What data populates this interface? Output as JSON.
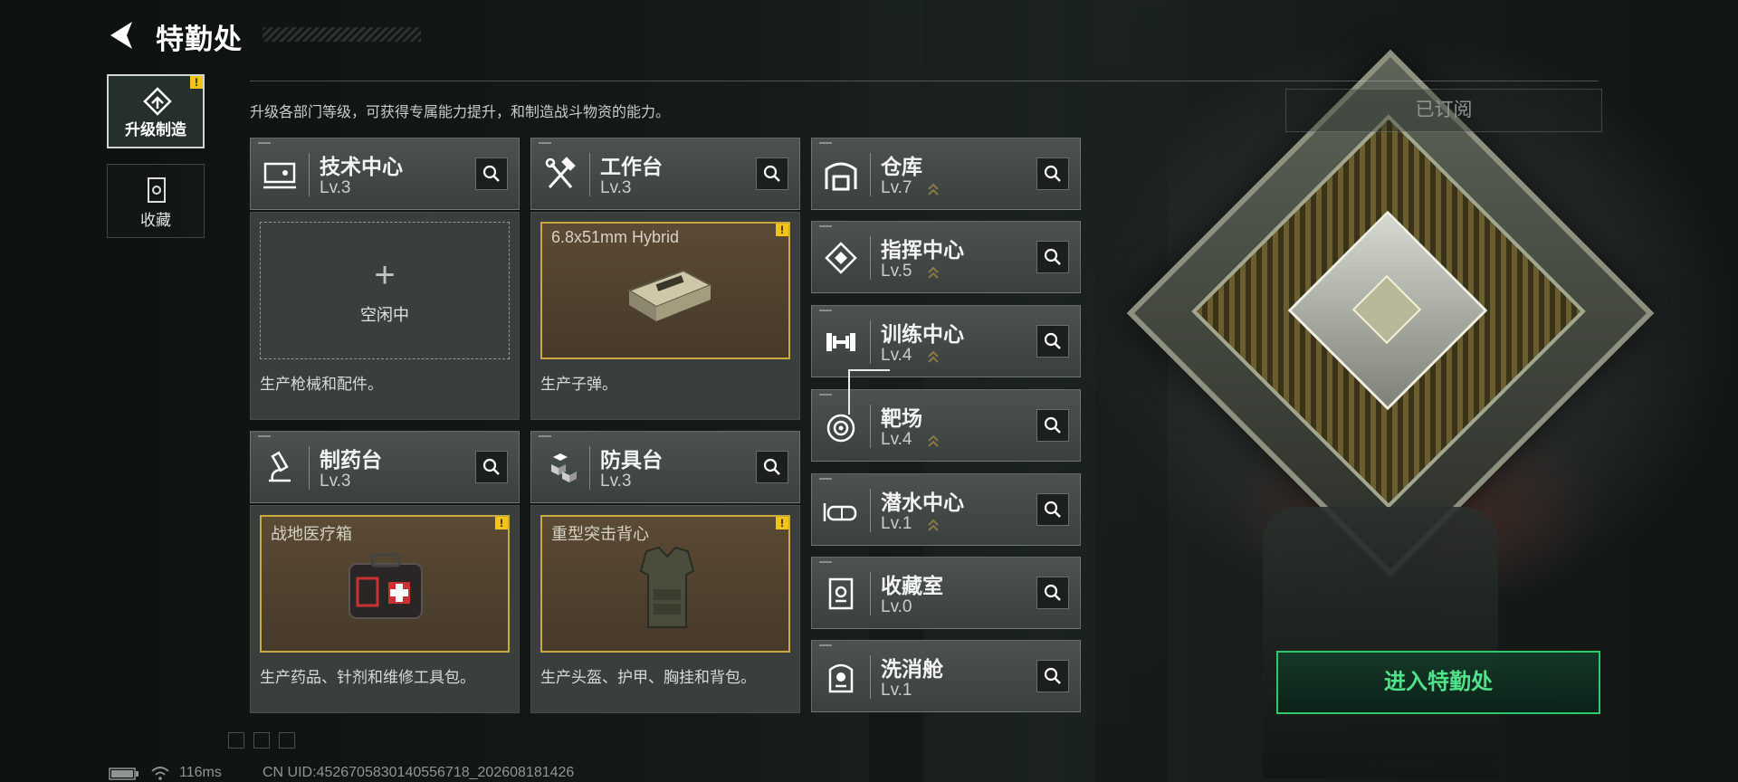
{
  "header": {
    "title": "特勤处",
    "description": "升级各部门等级，可获得专属能力提升，和制造战斗物资的能力。"
  },
  "nav": [
    {
      "label": "升级制造",
      "active": true,
      "badge": "!"
    },
    {
      "label": "收藏",
      "active": false
    }
  ],
  "subscribed_label": "已订阅",
  "departments": {
    "tech": {
      "name": "技术中心",
      "level": "Lv.3"
    },
    "workbench": {
      "name": "工作台",
      "level": "Lv.3"
    },
    "pharmacy": {
      "name": "制药台",
      "level": "Lv.3"
    },
    "armor": {
      "name": "防具台",
      "level": "Lv.3"
    },
    "storage": {
      "name": "仓库",
      "level": "Lv.7"
    },
    "command": {
      "name": "指挥中心",
      "level": "Lv.5"
    },
    "training": {
      "name": "训练中心",
      "level": "Lv.4"
    },
    "range": {
      "name": "靶场",
      "level": "Lv.4"
    },
    "diving": {
      "name": "潜水中心",
      "level": "Lv.1"
    },
    "collection": {
      "name": "收藏室",
      "level": "Lv.0"
    },
    "decon": {
      "name": "洗消舱",
      "level": "Lv.1"
    }
  },
  "production": {
    "tech": {
      "idle_plus": "+",
      "idle_text": "空闲中",
      "desc": "生产枪械和配件。"
    },
    "workbench": {
      "item": "6.8x51mm Hybrid",
      "desc": "生产子弹。",
      "badge": "!"
    },
    "pharmacy": {
      "item": "战地医疗箱",
      "desc": "生产药品、针剂和维修工具包。",
      "badge": "!"
    },
    "armor": {
      "item": "重型突击背心",
      "desc": "生产头盔、护甲、胸挂和背包。",
      "badge": "!"
    }
  },
  "enter_button": "进入特勤处",
  "status": {
    "ping": "116ms",
    "uid": "CN UID:4526705830140556718_202608181426"
  },
  "colors": {
    "accent_green": "#2fc86a",
    "warning_yellow": "#f0c419",
    "gold_border": "#c9a83f"
  }
}
